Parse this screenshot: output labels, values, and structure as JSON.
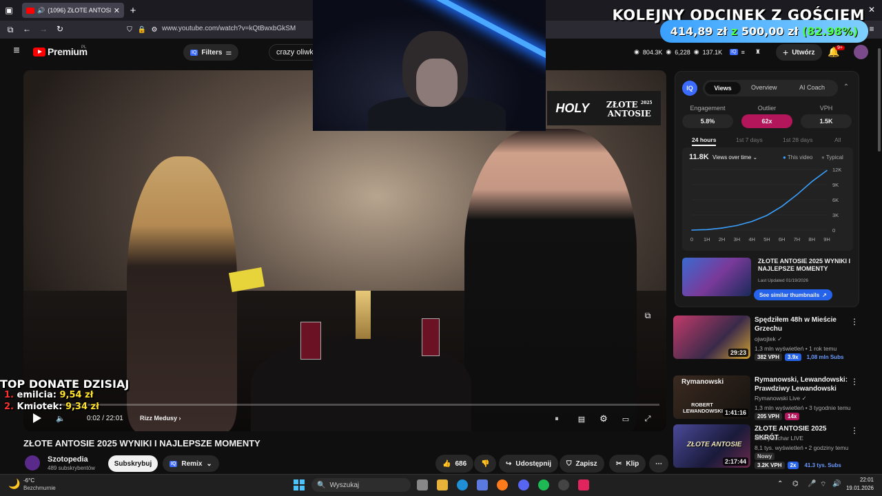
{
  "browser": {
    "tab_title": "(1096) ZŁOTE ANTOSIE 202",
    "url": "www.youtube.com/watch?v=kQtBwxbGkSM"
  },
  "yt_header": {
    "logo_text": "Premium",
    "logo_sup": "PL",
    "filters_label": "Filters",
    "search_value": "crazy oliwk",
    "stat_1": "804.3K",
    "stat_2": "6,228",
    "stat_3": "137.1K",
    "create_label": "Utwórz",
    "notif_count": "9+"
  },
  "overlay": {
    "goal_title": "KOLEJNY ODCINEK Z GOŚCIEM",
    "goal_current": "414,89 zł",
    "goal_z": "z",
    "goal_target": "500,00 zł",
    "goal_percent": "(82.98%)",
    "goal_fraction": 0.8298,
    "donate_header": "TOP DONATE DZISIAJ",
    "donors": [
      {
        "rank": "1.",
        "name": "emilcia:",
        "amount": "9,54 zł"
      },
      {
        "rank": "2.",
        "name": "Kmiotek:",
        "amount": "9,34 zł"
      }
    ]
  },
  "video": {
    "banner_holy": "HOLY",
    "banner_line1": "ZŁOTE",
    "banner_line2": "ANTOSIE",
    "banner_year": "2025",
    "time": "0:02 / 22:01",
    "chapter": "Rizz Medusy",
    "progress_fraction": 0.0015
  },
  "meta": {
    "title": "ZŁOTE ANTOSIE 2025 WYNIKI I NAJLEPSZE MOMENTY",
    "channel": "Szotopedia",
    "subs": "489 subskrybentów",
    "subscribe_label": "Subskrybuj",
    "remix_label": "Remix",
    "likes": "686",
    "share_label": "Udostępnij",
    "save_label": "Zapisz",
    "clip_label": "Klip"
  },
  "iq_panel": {
    "logo": "IQ",
    "tabs": [
      "Views",
      "Overview",
      "AI Coach"
    ],
    "stats": [
      {
        "label": "Engagement",
        "value": "5.8%"
      },
      {
        "label": "Outlier",
        "value": "62x"
      },
      {
        "label": "VPH",
        "value": "1.5K"
      }
    ],
    "ranges": [
      "24 hours",
      "1st 7 days",
      "1st 28 days",
      "All"
    ],
    "total": "11.8K",
    "views_dropdown": "Views over time",
    "legend_this": "This video",
    "legend_typical": "Typical",
    "featured_title": "ZŁOTE ANTOSIE 2025 WYNIKI I NAJLEPSZE MOMENTY",
    "featured_updated": "Last Updated 01/19/2026",
    "similar_label": "See similar thumbnails"
  },
  "chart_data": {
    "type": "line",
    "x": [
      "0",
      "1H",
      "2H",
      "3H",
      "4H",
      "5H",
      "6H",
      "7H",
      "8H",
      "9H"
    ],
    "series": [
      {
        "name": "This video",
        "values": [
          0,
          100,
          400,
          900,
          1700,
          2900,
          4700,
          7000,
          9600,
          11800
        ]
      }
    ],
    "ylim": [
      0,
      12000
    ],
    "yticks": [
      "12K",
      "9K",
      "6K",
      "3K",
      "0"
    ]
  },
  "recommendations": [
    {
      "title": "Spędziłem 48h w Mieście Grzechu",
      "channel": "ojwojtek",
      "stats": "1,3 mln wyświetleń • 1 rok temu",
      "vph": "382 VPH",
      "mult": "3.9x",
      "subs": "1,08 mln Subs",
      "duration": "29:23",
      "color": "#6a2a5a"
    },
    {
      "title": "Rymanowski, Lewandowski: Prawdziwy Lewandowski",
      "channel": "Rymanowski Live",
      "stats": "1,3 mln wyświetleń • 3 tygodnie temu",
      "vph": "205 VPH",
      "mult": "14x",
      "subs": "",
      "duration": "1:41:16",
      "color": "#2a2520",
      "thumb_top": "Rymanowski",
      "thumb_bottom": "ROBERT LEWANDOWSKI"
    },
    {
      "title": "ZŁOTE ANTOSIE 2025 SKRÓT",
      "channel": "MokrySuchar LIVE",
      "stats": "8,1 tys. wyświetleń • 2 godziny temu",
      "new_label": "Nowy",
      "vph": "3.2K VPH",
      "mult": "2x",
      "subs": "41.3 tys. Subs",
      "duration": "2:17:44",
      "color": "#3a3a7a",
      "thumb_text": "ZŁOTE ANTOSIE"
    }
  ],
  "taskbar": {
    "weather_temp": "-6°C",
    "weather_desc": "Bezchmurnie",
    "search_placeholder": "Wyszukaj",
    "time": "22:01",
    "date": "19.01.2026"
  }
}
